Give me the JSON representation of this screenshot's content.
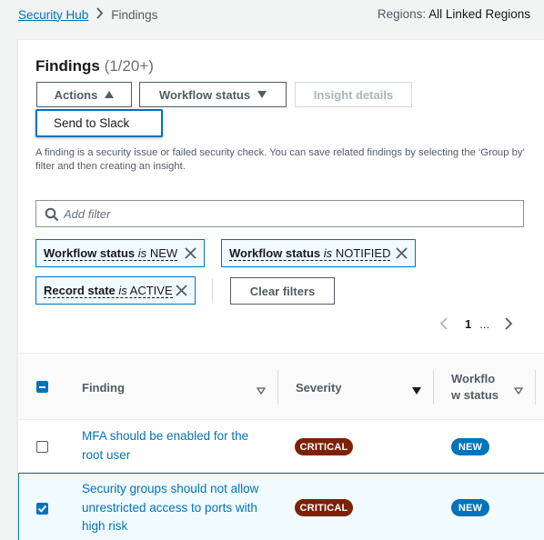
{
  "breadcrumb": {
    "root": "Security Hub",
    "current": "Findings"
  },
  "regions": {
    "label": "Regions:",
    "value": "All Linked Regions"
  },
  "panel": {
    "title": "Findings",
    "count": "(1/20+)"
  },
  "toolbar": {
    "actions_label": "Actions",
    "workflow_status_label": "Workflow status",
    "insight_details_label": "Insight details"
  },
  "actions_menu": {
    "items": [
      {
        "label": "Send to Slack"
      }
    ]
  },
  "description": "A finding is a security issue or failed security check. You can save related findings by selecting the ‘Group by’ filter and then creating an insight.",
  "search": {
    "placeholder": "Add filter",
    "value": ""
  },
  "filters": [
    {
      "key": "Workflow status",
      "operator": "is",
      "value": "NEW"
    },
    {
      "key": "Workflow status",
      "operator": "is",
      "value": "NOTIFIED"
    },
    {
      "key": "Record state",
      "operator": "is",
      "value": "ACTIVE"
    }
  ],
  "clear_filters_label": "Clear filters",
  "pagination": {
    "current_page": "1",
    "ellipsis": "..."
  },
  "table": {
    "columns": [
      {
        "label": "Finding"
      },
      {
        "label": "Severity"
      },
      {
        "label": "Workflo w status"
      }
    ],
    "rows": [
      {
        "finding": "MFA should be enabled for the root user",
        "severity": "CRITICAL",
        "workflow_status": "NEW",
        "selected": false
      },
      {
        "finding": "Security groups should not allow unrestricted access to ports with high risk",
        "severity": "CRITICAL",
        "workflow_status": "NEW",
        "selected": true
      }
    ]
  },
  "colors": {
    "link": "#0073bb",
    "critical_badge": "#7d2105",
    "new_badge": "#0073bb",
    "selected_row_bg": "#f1faff"
  },
  "icons": [
    "chevron-right-icon",
    "caret-up-icon",
    "caret-down-icon",
    "search-icon",
    "close-icon",
    "chevron-left-icon",
    "sort-icon"
  ]
}
